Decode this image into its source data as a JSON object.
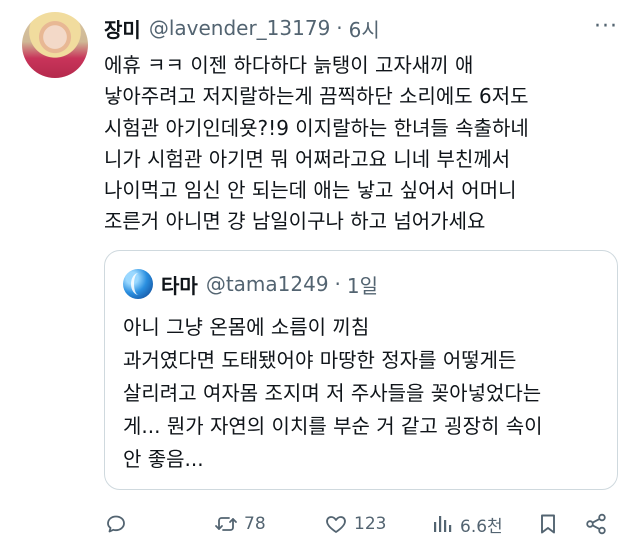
{
  "tweet": {
    "author_name": "장미",
    "handle": "@lavender_13179",
    "separator": "·",
    "time": "6시",
    "more_label": "···",
    "text": "에휴 ㅋㅋ 이젠 하다하다 늙탱이 고자새끼 애\n낳아주려고 저지랄하는게 끔찍하단 소리에도 6저도\n시험관 아기인데욧?!9 이지랄하는 한녀들 속출하네\n니가 시험관 아기면 뭐 어쩌라고요 니네 부친께서\n나이먹고 임신 안 되는데 애는 낳고 싶어서 어머니\n조른거 아니면 걍 남일이구나 하고 넘어가세요"
  },
  "quote": {
    "author_name": "타마",
    "handle": "@tama1249",
    "separator": "·",
    "time": "1일",
    "text": "아니 그냥 온몸에 소름이 끼침\n과거였다면 도태됐어야 마땅한 정자를 어떻게든\n살리려고 여자몸 조지며 저 주사들을 꽂아넣었다는\n게... 뭔가 자연의 이치를 부순 거 같고 굉장히 속이\n안 좋음..."
  },
  "actions": {
    "reply_count": "",
    "retweet_count": "78",
    "like_count": "123",
    "views_count": "6.6천"
  },
  "icons": {
    "reply": "reply-icon",
    "retweet": "retweet-icon",
    "like": "heart-icon",
    "views": "views-chart-icon",
    "bookmark": "bookmark-icon",
    "share": "share-icon",
    "more": "more-dots-icon"
  },
  "colors": {
    "text": "#0f1419",
    "muted": "#536471",
    "border": "#cfd9de"
  }
}
